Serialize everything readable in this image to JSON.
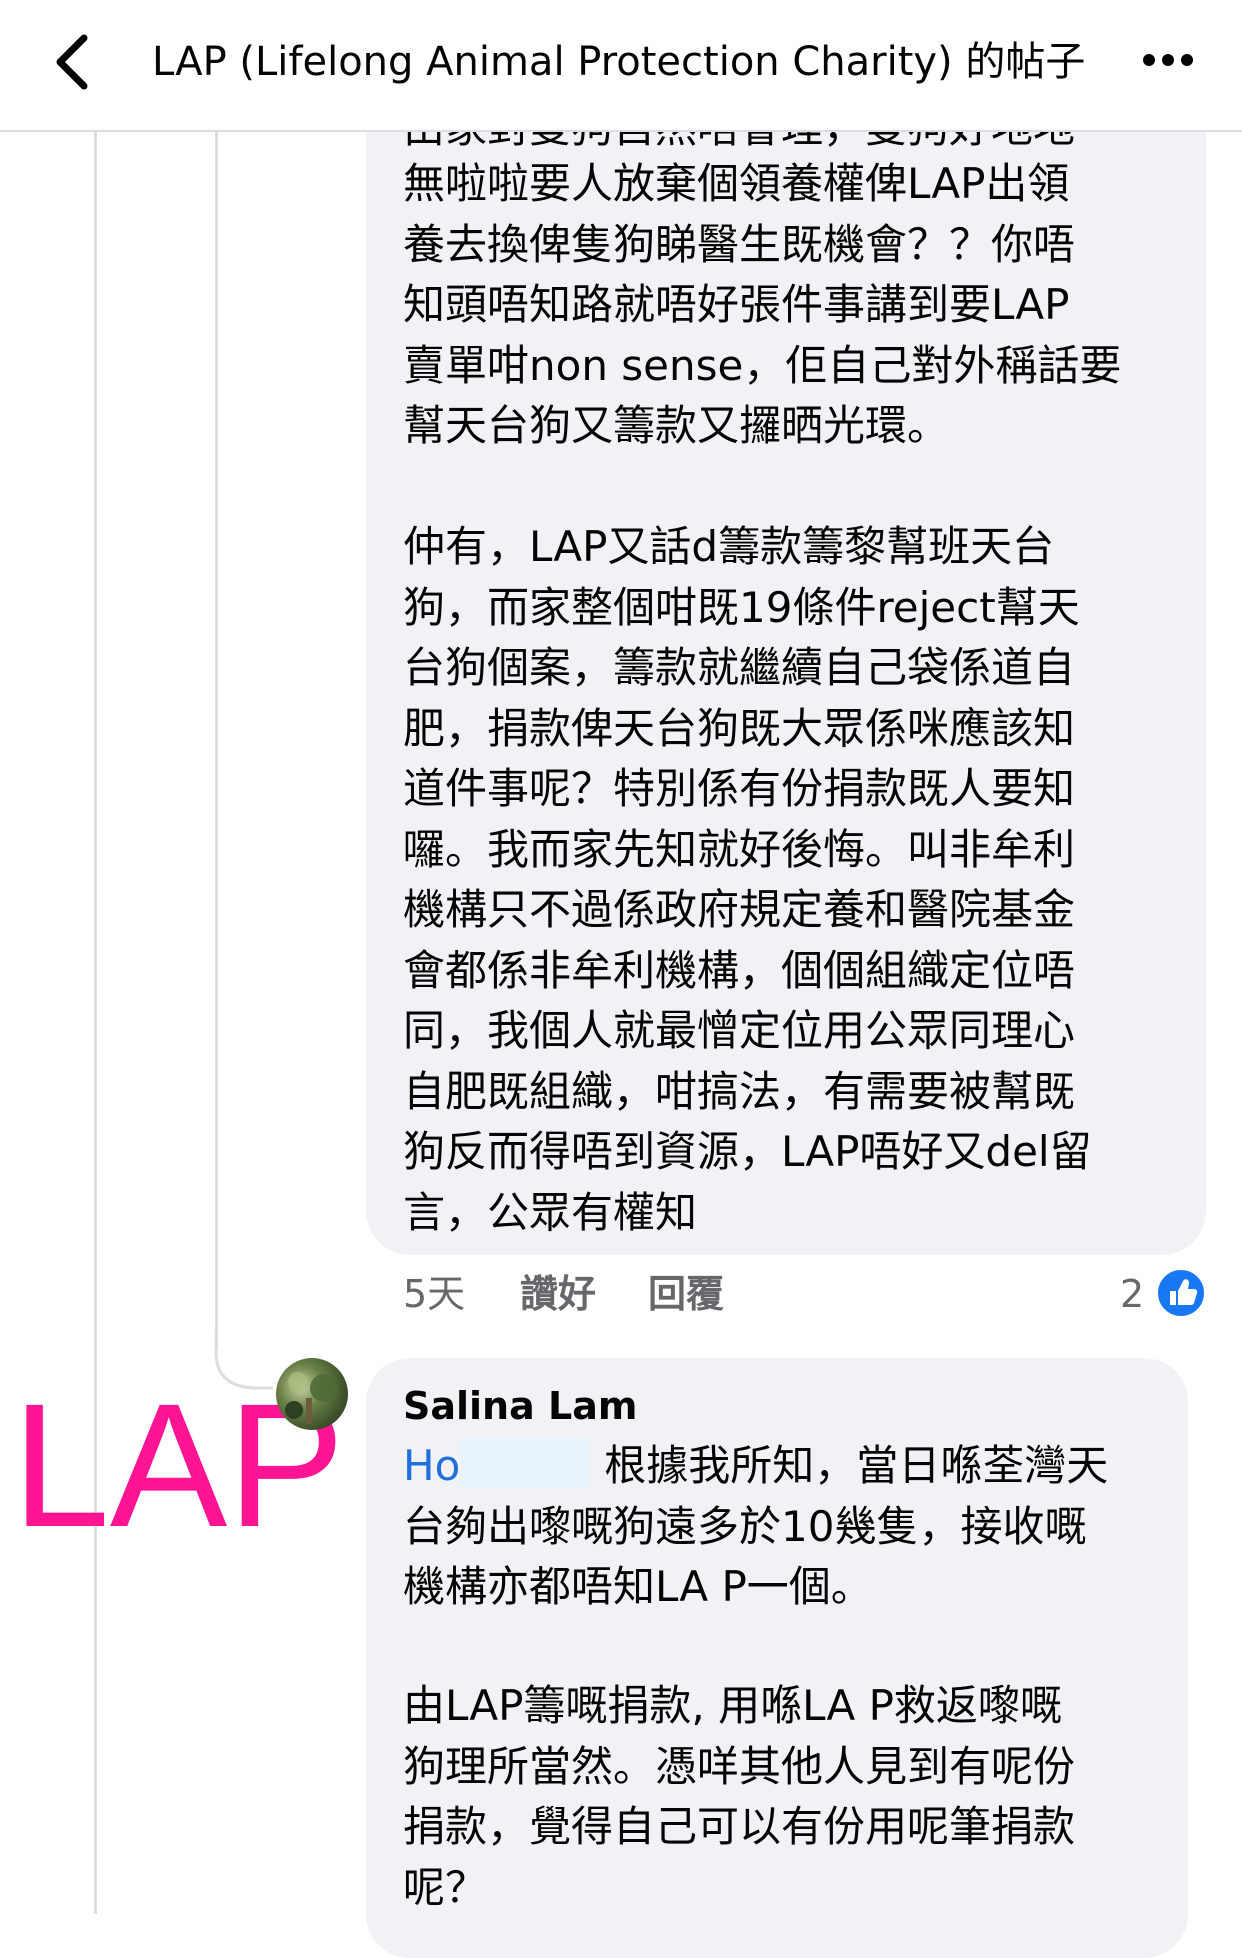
{
  "header": {
    "title": "LAP (Lifelong Animal Protection Charity) 的帖子",
    "back_icon": "chevron-left-icon",
    "more_icon": "more-horizontal-icon"
  },
  "comment1": {
    "partial_top_line": "由家對隻狗自然唔會理，隻狗好地地",
    "body_part1": "無啦啦要人放棄個領養權俾LAP出領\n養去換俾隻狗睇醫生既機會？？你唔\n知頭唔知路就唔好張件事講到要LAP\n賣單咁non sense，佢自己對外稱話要\n幫天台狗又籌款又攞晒光環。",
    "body_part2": "仲有，LAP又話d籌款籌黎幫班天台\n狗，而家整個咁既19條件reject幫天\n台狗個案，籌款就繼續自己袋係道自\n肥，捐款俾天台狗既大眾係咪應該知\n道件事呢？特別係有份捐款既人要知\n囉。我而家先知就好後悔。叫非牟利\n機構只不過係政府規定養和醫院基金\n會都係非牟利機構，個個組織定位唔\n同，我個人就最憎定位用公眾同理心\n自肥既組織，咁搞法，有需要被幫既\n狗反而得唔到資源，LAP唔好又del留\n言，公眾有權知",
    "time": "5天",
    "like_label": "讚好",
    "reply_label": "回覆",
    "like_count": "2"
  },
  "comment2": {
    "author": "Salina Lam",
    "mention": "Ho",
    "body_part1": "根據我所知，當日喺荃灣天\n台夠出嚟嘅狗遠多於10幾隻，接收嘅\n機構亦都唔知LA P一個。",
    "body_part2": "由LAP籌嘅捐款, 用喺LA P救返嚟嘅\n狗理所當然。憑咩其他人見到有呢份\n捐款，覺得自己可以有份用呢筆捐款\n呢？"
  },
  "watermark": "LAP",
  "colors": {
    "bubble": "#f0f2f5",
    "link": "#216fdb",
    "watermark": "#ff1493",
    "like_blue": "#1877f2"
  }
}
